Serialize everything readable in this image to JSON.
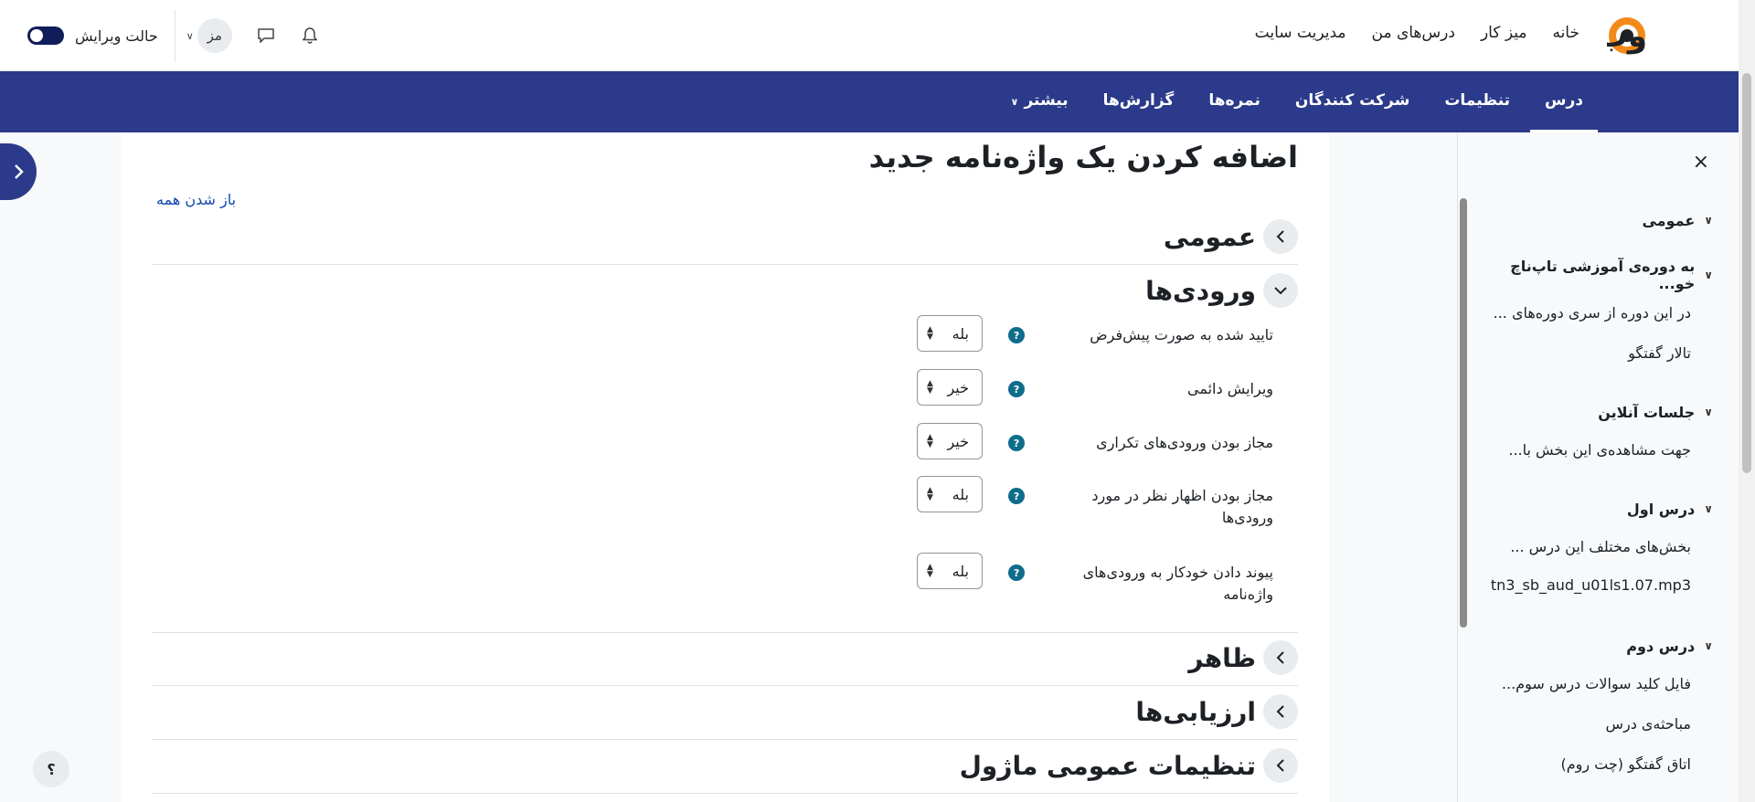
{
  "topbar": {
    "logo_text": "وب",
    "primary_nav": [
      "خانه",
      "میز کار",
      "درس‌های من",
      "مدیریت سایت"
    ],
    "avatar_initials": "مز",
    "edit_mode_label": "حالت ویرایش"
  },
  "secondary_nav": {
    "items": [
      "درس",
      "تنظیمات",
      "شرکت کنندگان",
      "نمره‌ها",
      "گزارش‌ها",
      "بیشتر"
    ],
    "active_index": 0
  },
  "drawer": {
    "close_symbol": "×",
    "sections": [
      {
        "title": "عمومی",
        "items": []
      },
      {
        "title": "به دوره‌ی آموزشی تاپ‌ناچ خو...",
        "items": [
          "در این دوره از سری دوره‌های ...",
          "تالار گفتگو"
        ]
      },
      {
        "title": "جلسات آنلاین",
        "items": [
          "جهت مشاهده‌ی این بخش با..."
        ]
      },
      {
        "title": "درس اول",
        "items": [
          "بخش‌های مختلف این درس ...",
          "tn3_sb_aud_u01ls1.07.mp3"
        ]
      },
      {
        "title": "درس دوم",
        "items": [
          "فایل کلید سوالات درس سوم...",
          "مباحثه‌ی درس",
          "اتاق گفتگو (چت روم)"
        ]
      }
    ]
  },
  "main": {
    "title": "اضافه کردن یک واژه‌نامه جدید",
    "expand_all": "باز شدن همه",
    "sections": [
      "عمومی",
      "ورودی‌ها",
      "ظاهر",
      "ارزیابی‌ها",
      "تنظیمات عمومی ماژول"
    ],
    "entries": [
      {
        "label": "تایید شده به صورت پیش‌فرض",
        "value": "بله"
      },
      {
        "label": "ویرایش دائمی",
        "value": "خیر"
      },
      {
        "label": "مجاز بودن ورودی‌های تکراری",
        "value": "خیر"
      },
      {
        "label": "مجاز بودن اظهار نظر در مورد ورودی‌ها",
        "value": "بله"
      },
      {
        "label": "پیوند دادن خودکار به ورودی‌های واژه‌نامه",
        "value": "بله"
      }
    ]
  },
  "help_button": "؟",
  "colors": {
    "primary_nav_bg": "#2b3a8a",
    "link": "#0f47ad",
    "help_icon": "#0f6d8c"
  }
}
